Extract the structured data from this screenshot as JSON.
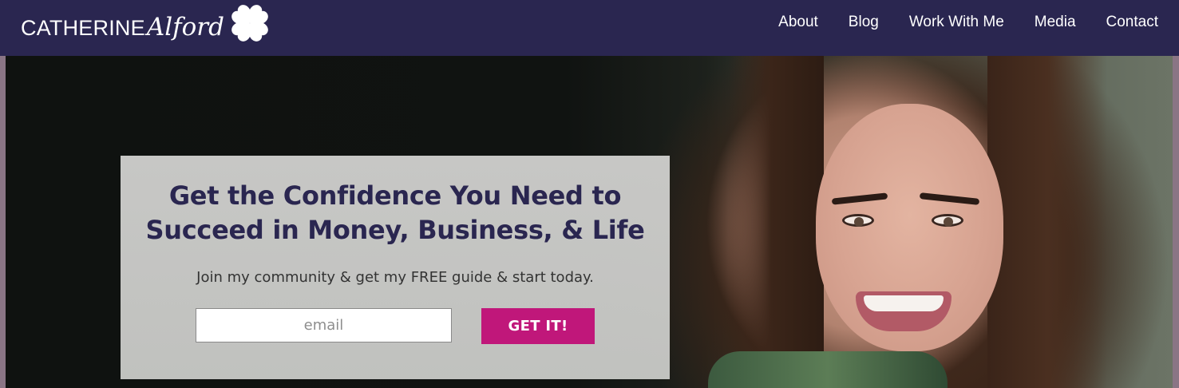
{
  "header": {
    "logo": {
      "first": "CATHERINE",
      "last": "Alford",
      "icon": "clover-hearts-icon"
    },
    "nav": [
      "About",
      "Blog",
      "Work With Me",
      "Media",
      "Contact"
    ]
  },
  "colors": {
    "header_bg": "#2a2650",
    "title": "#2a2650",
    "cta": "#c0177a"
  },
  "hero": {
    "headline": [
      "Get the Confidence You Need to",
      "Succeed in Money, Business, & Life"
    ],
    "subtext": "Join my community & get my FREE guide & start today.",
    "email_placeholder": "email",
    "email_value": "",
    "cta_label": "GET IT!"
  }
}
